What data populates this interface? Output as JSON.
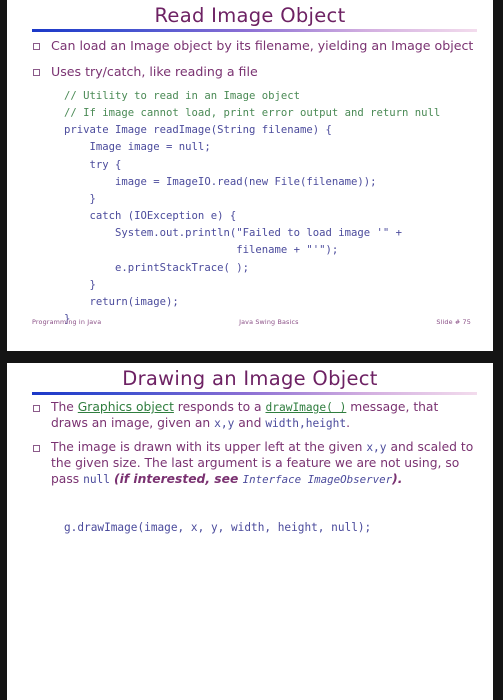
{
  "theme": {
    "title_color": "#6d2163",
    "body_color": "#7a3271",
    "code_color": "#4b4b9c",
    "comment_color": "#4a8a55",
    "link_color": "#2f7d3e",
    "rule_start_color": "#1b38c8",
    "rule_end_color": "#f3dced",
    "frame_color": "#141414",
    "slide_background": "#ffffff"
  },
  "slides": [
    {
      "title": "Read Image Object",
      "bullets": [
        {
          "marker": "square-bullet",
          "text": "Can load an Image object by its filename, yielding an Image object"
        },
        {
          "marker": "square-bullet",
          "text": "Uses try/catch, like reading a file"
        }
      ],
      "code": {
        "comment_line_1": "// Utility to read in an Image object",
        "comment_line_2": "// If image cannot load, print error output and return null",
        "lines": [
          "private Image readImage(String filename) {",
          "    Image image = null;",
          "    try {",
          "        image = ImageIO.read(new File(filename));",
          "    }",
          "    catch (IOException e) {",
          "        System.out.println(\"Failed to load image '\" +",
          "                           filename + \"'\");",
          "        e.printStackTrace( );",
          "    }",
          "    return(image);",
          "}"
        ]
      },
      "footer": {
        "left": "Programming in Java",
        "center": "Java Swing Basics",
        "right": "Slide # 75"
      }
    },
    {
      "title": "Drawing an Image Object",
      "bullets": [
        {
          "marker": "square-bullet",
          "segments": [
            {
              "style": "plain",
              "text": "The "
            },
            {
              "style": "link",
              "text": "Graphics object"
            },
            {
              "style": "plain",
              "text": " responds to a "
            },
            {
              "style": "link-mono",
              "text": "drawImage( )"
            },
            {
              "style": "plain",
              "text": " message, that draws an image, given an "
            },
            {
              "style": "mono",
              "text": "x,y"
            },
            {
              "style": "plain",
              "text": " and "
            },
            {
              "style": "mono",
              "text": "width,height"
            },
            {
              "style": "plain",
              "text": "."
            }
          ]
        },
        {
          "marker": "square-bullet",
          "segments": [
            {
              "style": "plain",
              "text": "The image is drawn with its upper left at the given "
            },
            {
              "style": "mono",
              "text": "x,y"
            },
            {
              "style": "plain",
              "text": " and scaled to the given size. The last argument is a feature we are not using, so pass "
            },
            {
              "style": "mono",
              "text": "null"
            },
            {
              "style": "plain",
              "text": " "
            },
            {
              "style": "italic",
              "text": "(if interested, see "
            },
            {
              "style": "italic-mono",
              "text": "Interface ImageObserver"
            },
            {
              "style": "italic",
              "text": ")."
            }
          ]
        }
      ],
      "code": {
        "lines": [
          "g.drawImage(image, x, y, width, height, null);"
        ]
      }
    }
  ]
}
